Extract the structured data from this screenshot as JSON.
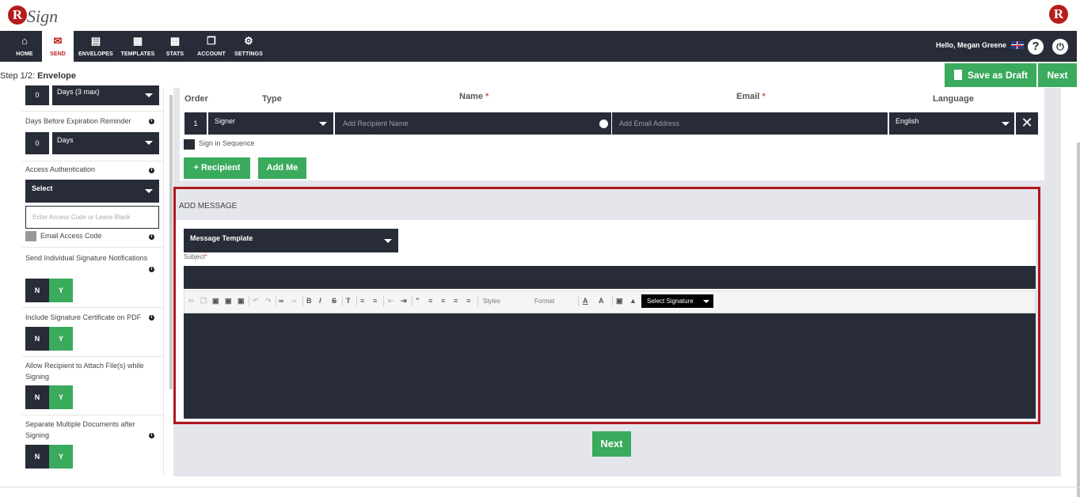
{
  "brand": {
    "logo_letter": "R",
    "logo_text": "Sign",
    "right_logo_letter": "R"
  },
  "nav": {
    "items": [
      {
        "label": "HOME",
        "icon": "home-icon"
      },
      {
        "label": "SEND",
        "icon": "envelope-icon"
      },
      {
        "label": "ENVELOPES",
        "icon": "inbox-icon"
      },
      {
        "label": "TEMPLATES",
        "icon": "document-icon"
      },
      {
        "label": "STATS",
        "icon": "briefcase-icon"
      },
      {
        "label": "ACCOUNT",
        "icon": "copy-icon"
      },
      {
        "label": "SETTINGS",
        "icon": "gear-icon"
      }
    ],
    "greeting": "Hello, Megan Greene",
    "help": "?",
    "power": "⏻"
  },
  "stepbar": {
    "step_prefix": "Step 1/2: ",
    "step_name": "Envelope",
    "save_draft": "Save as Draft",
    "next": "Next"
  },
  "left": {
    "reminder_value": "0",
    "reminder_unit": "Days (3 max)",
    "expiry_label": "Days Before Expiration Reminder",
    "expiry_value": "0",
    "expiry_unit": "Days",
    "access_label": "Access Authentication",
    "access_select": "Select",
    "access_placeholder": "Enter Access Code or Leave Blank",
    "email_code_label": "Email Access Code",
    "individual_label": "Send Individual Signature Notifications",
    "certificate_label": "Include Signature Certificate on PDF",
    "attach_label": "Allow Recipient to Attach File(s) while Signing",
    "separate_label": "Separate Multiple Documents after Signing",
    "n": "N",
    "y": "Y"
  },
  "recipients": {
    "headers": {
      "order": "Order",
      "type": "Type",
      "name": "Name",
      "email": "Email",
      "language": "Language"
    },
    "required_mark": "*",
    "row": {
      "order": "1",
      "type": "Signer",
      "name_placeholder": "Add Recipient Name",
      "email_placeholder": "Add Email Address",
      "language": "English"
    },
    "sequence_label": "Sign in Sequence",
    "add_recipient": "+ Recipient",
    "add_me": "Add Me"
  },
  "message": {
    "header": "ADD MESSAGE",
    "template_select": "Message Template",
    "subject_label": "Subject",
    "required_mark": "*",
    "styles": "Styles",
    "format": "Format",
    "signature_select": "Select Signature",
    "next": "Next"
  },
  "colors": {
    "nav_bg": "#272c38",
    "brand_red": "#b71c1c",
    "green": "#3aaa5c",
    "highlight": "#b0171e"
  }
}
